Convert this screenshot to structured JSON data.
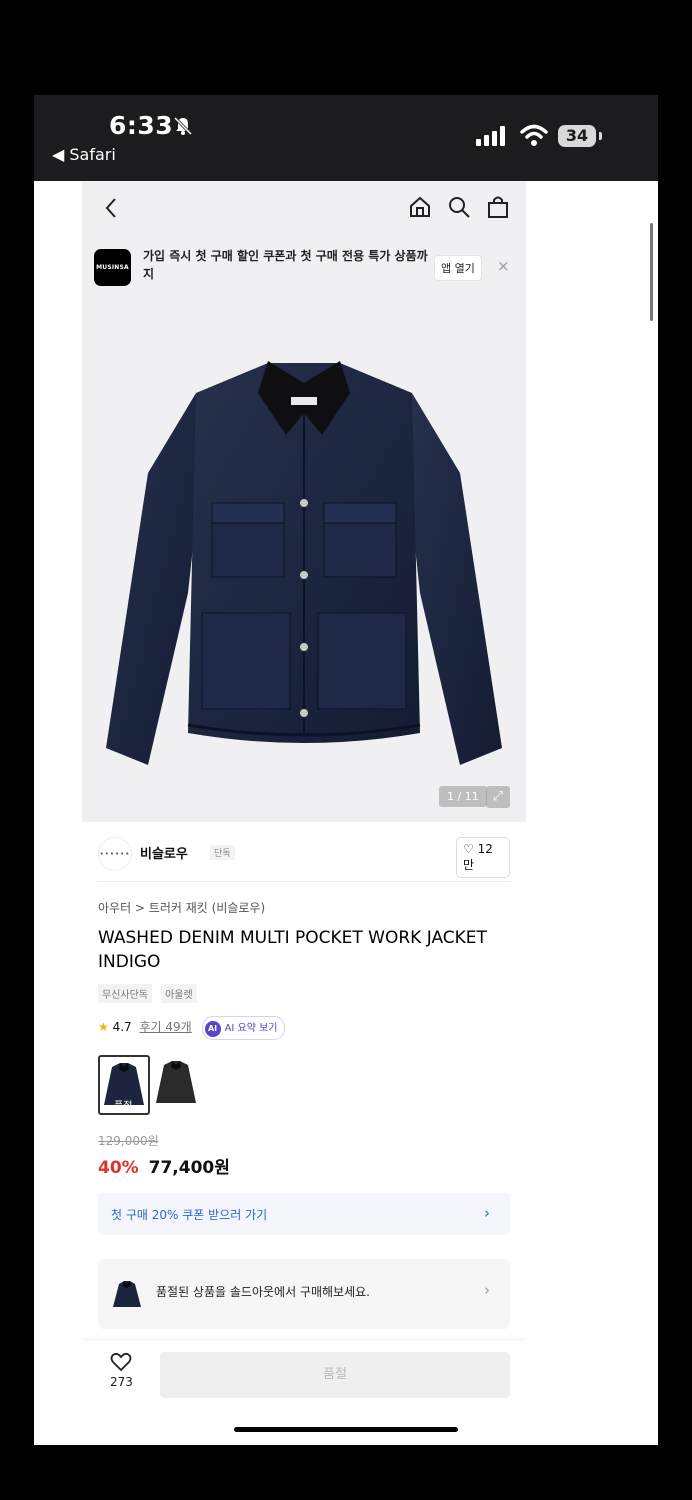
{
  "status_bar": {
    "time": "6:33",
    "back_app": "◀ Safari",
    "battery": "34"
  },
  "banner": {
    "logo_text": "MUSINSA",
    "text": "가입 즉시 첫 구매 할인 쿠폰과 첫 구매 전용 특가 상품까지",
    "open_app": "앱 열기",
    "close": "×"
  },
  "gallery": {
    "counter": "1 / 11"
  },
  "brand": {
    "logo_text": "••••••",
    "name": "비슬로우",
    "tag": "단독",
    "likes": "12만"
  },
  "product": {
    "breadcrumb": "아우터 > 트러커 재킷 (비슬로우)",
    "title": "WASHED DENIM MULTI POCKET WORK JACKET INDIGO",
    "tags": [
      "무신사단독",
      "아울렛"
    ],
    "rating": "4.7",
    "reviews": "후기 49개",
    "ai_label": "AI 요약 보기",
    "soldout_label": "품절",
    "original_price": "129,000원",
    "discount": "40%",
    "price": "77,400원"
  },
  "coupon": {
    "text": "첫 구매 20% 쿠폰 받으러 가기"
  },
  "resell": {
    "text": "품절된 상품을 솔드아웃에서 구매해보세요."
  },
  "bottom": {
    "wish_count": "273",
    "buy_label": "품절"
  },
  "colors": {
    "accent_red": "#e0312d",
    "link_blue": "#2567d9",
    "ai_purple": "#5a43c7"
  }
}
